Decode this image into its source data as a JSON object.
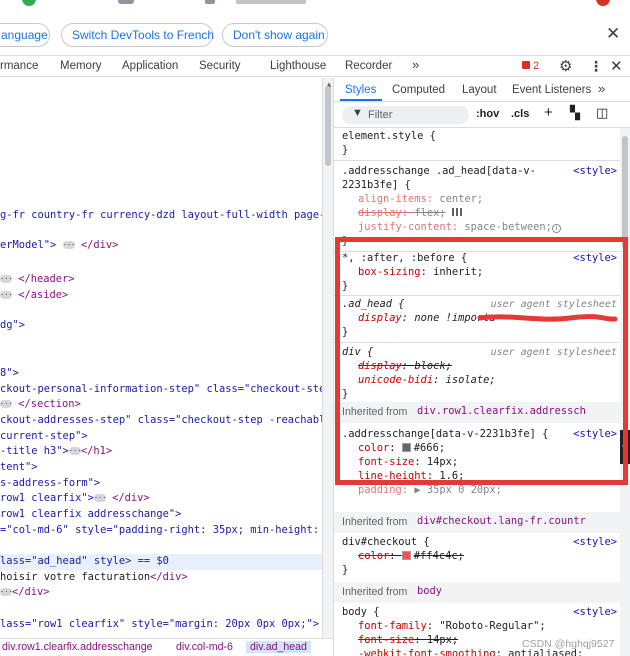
{
  "infobar": {
    "language_btn": "anguage",
    "switch_btn": "Switch DevTools to French",
    "dont_show_btn": "Don't show again",
    "close_icon": "close-icon"
  },
  "tabs": [
    "rmance",
    "Memory",
    "Application",
    "Security",
    "Lighthouse",
    "Recorder"
  ],
  "tabs_more": "»",
  "issues_badge": "2",
  "elements_lines": [
    {
      "pre": "",
      "text": "g-fr country-fr currency-dzd layout-full-width page-o"
    },
    {
      "pre": "erModel\"> ",
      "text": "</div>"
    },
    {
      "pre": "",
      "text": "</header>"
    },
    {
      "pre": "",
      "text": "</aside>"
    },
    {
      "pre": "dg\">",
      "text": ""
    },
    {
      "pre": "8\">",
      "text": ""
    },
    {
      "pre": "ckout-personal-information-step\" class=\"checkout-step",
      "text": ""
    },
    {
      "pre": "",
      "text": "</section>"
    },
    {
      "pre": "ckout-addresses-step\" class=\"checkout-step -reachable",
      "text": ""
    },
    {
      "pre": "current-step\">",
      "text": ""
    },
    {
      "pre": "-title h3\">",
      "text": "</h1>"
    },
    {
      "pre": "tent\">",
      "text": ""
    },
    {
      "pre": "s-address-form\">",
      "text": ""
    },
    {
      "pre": "row1 clearfix\">",
      "text": "</div>"
    },
    {
      "pre": "row1 clearfix addresschange\">",
      "text": ""
    },
    {
      "pre": "=\"col-md-6\" style=\"padding-right: 35px; min-height:",
      "text": ""
    },
    {
      "pre": "lass=\"ad_head\" style> == $0",
      "text": ""
    },
    {
      "pre": "hoisir votre facturation",
      "text": "</div>"
    },
    {
      "pre": "",
      "text": "</div>"
    },
    {
      "pre": "lass=\"row1 clearfix\" style=\"margin: 20px 0px 0px;\">",
      "text": ""
    }
  ],
  "breadcrumb": [
    "div.row1.clearfix.addresschange",
    "div.col-md-6",
    "div.ad_head"
  ],
  "styles": {
    "subtabs": [
      "Styles",
      "Computed",
      "Layout",
      "Event Listeners"
    ],
    "subtabs_more": "»",
    "filter_placeholder": "Filter",
    "hov": ":hov",
    "cls": ".cls",
    "element_style": "element.style {",
    "close_brace": "}",
    "rule1": {
      "selector_a": ".addresschange .ad_head[data-v-",
      "selector_b": "2231b3fe] {",
      "source": "<style>",
      "decls": [
        {
          "prop": "align-items",
          "value": "center;",
          "disabled": true
        },
        {
          "prop": "display",
          "value": "flex;",
          "disabled": true,
          "strike": true
        },
        {
          "prop": "justify-content",
          "value": "space-between;",
          "disabled": true
        }
      ]
    },
    "rule2": {
      "selector": "*, :after, :before {",
      "source": "<style>",
      "decl": {
        "prop": "box-sizing",
        "value": "inherit;"
      }
    },
    "rule3": {
      "selector": ".ad_head {",
      "source": "user agent stylesheet",
      "decl": {
        "prop": "display",
        "value": "none !importa"
      }
    },
    "rule4": {
      "selector": "div {",
      "source": "user agent stylesheet",
      "decls": [
        {
          "prop": "display",
          "value": "block;"
        },
        {
          "prop": "unicode-bidi",
          "value": "isolate;"
        }
      ]
    },
    "inherited1": {
      "label": "Inherited from",
      "link": "div.row1.clearfix.addressch"
    },
    "rule5": {
      "selector": ".addresschange[data-v-2231b3fe] {",
      "source": "<style>",
      "decls": [
        {
          "prop": "color",
          "value": "#666;",
          "swatch": "#666666"
        },
        {
          "prop": "font-size",
          "value": "14px;"
        },
        {
          "prop": "line-height",
          "value": "1.6;"
        },
        {
          "prop": "padding",
          "value": "▶ 35px 0 20px;"
        }
      ]
    },
    "inherited2": {
      "label": "Inherited from",
      "link": "div#checkout.lang-fr.countr"
    },
    "rule6": {
      "selector": "div#checkout {",
      "source": "<style>",
      "decl": {
        "prop": "color",
        "value": "#ff4c4c;",
        "swatch": "#ff4c4c"
      }
    },
    "inherited3": {
      "label": "Inherited from",
      "link": "body"
    },
    "rule7": {
      "selector": "body {",
      "source": "<style>",
      "decls": [
        {
          "prop": "font-family",
          "value": "\"Roboto-Regular\";"
        },
        {
          "prop": "font-size",
          "value": "14px;"
        },
        {
          "prop": "-webkit-font-smoothing",
          "value": "antialiased;"
        }
      ]
    }
  },
  "watermark": "CSDN @hghqj9527",
  "colors": {
    "accent": "#1a73e8",
    "highlight_border": "#e53935",
    "error": "#d93025"
  }
}
